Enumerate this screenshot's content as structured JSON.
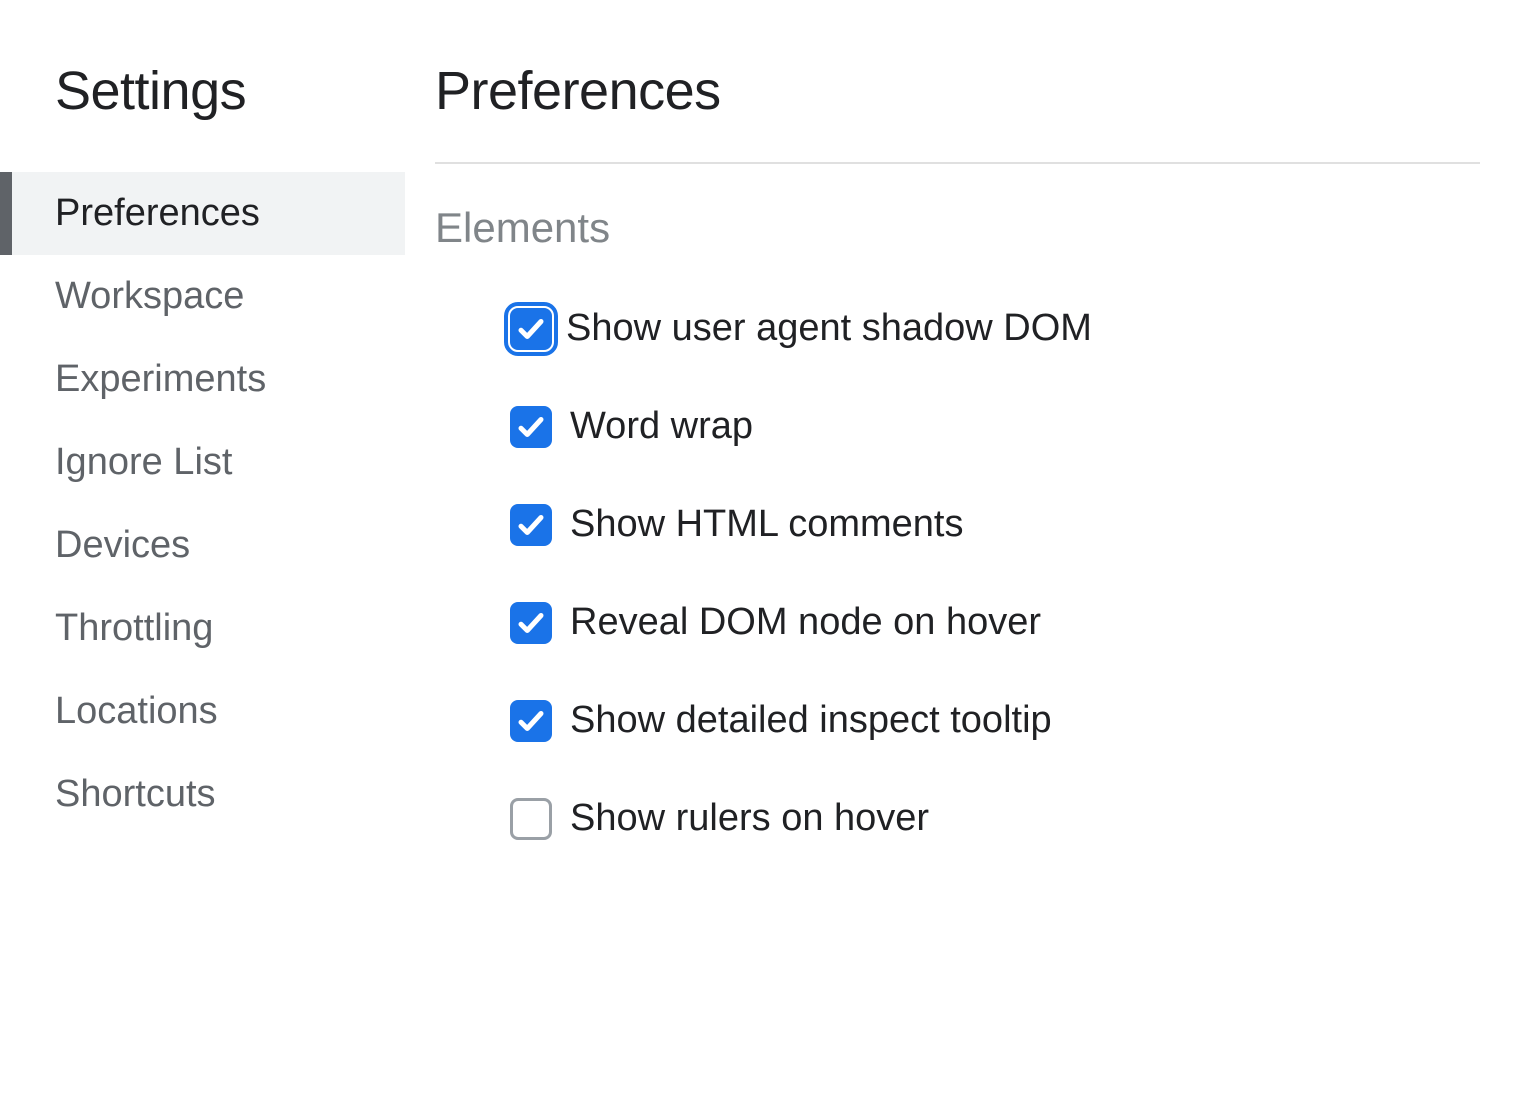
{
  "sidebar": {
    "title": "Settings",
    "items": [
      {
        "label": "Preferences",
        "active": true
      },
      {
        "label": "Workspace",
        "active": false
      },
      {
        "label": "Experiments",
        "active": false
      },
      {
        "label": "Ignore List",
        "active": false
      },
      {
        "label": "Devices",
        "active": false
      },
      {
        "label": "Throttling",
        "active": false
      },
      {
        "label": "Locations",
        "active": false
      },
      {
        "label": "Shortcuts",
        "active": false
      }
    ]
  },
  "main": {
    "title": "Preferences",
    "section": {
      "title": "Elements",
      "options": [
        {
          "label": "Show user agent shadow DOM",
          "checked": true,
          "focused": true
        },
        {
          "label": "Word wrap",
          "checked": true,
          "focused": false
        },
        {
          "label": "Show HTML comments",
          "checked": true,
          "focused": false
        },
        {
          "label": "Reveal DOM node on hover",
          "checked": true,
          "focused": false
        },
        {
          "label": "Show detailed inspect tooltip",
          "checked": true,
          "focused": false
        },
        {
          "label": "Show rulers on hover",
          "checked": false,
          "focused": false
        }
      ]
    }
  }
}
